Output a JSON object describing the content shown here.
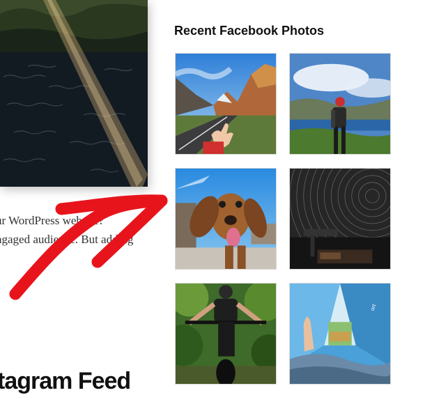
{
  "article": {
    "image_alt_name": "river-photo",
    "text_lines": [
      "ur WordPress website?",
      "ngaged audience. But adding"
    ],
    "heading": "tagram Feed"
  },
  "widget": {
    "title": "Recent Facebook Photos",
    "photos": [
      {
        "name": "mountain-road-photo"
      },
      {
        "name": "hiker-lake-photo"
      },
      {
        "name": "dog-tongue-photo"
      },
      {
        "name": "star-trails-photo"
      },
      {
        "name": "mountain-biker-photo"
      },
      {
        "name": "tent-interior-photo"
      }
    ]
  },
  "colors": {
    "arrow": "#e8141c",
    "title": "#111111",
    "body_text": "#333333"
  }
}
